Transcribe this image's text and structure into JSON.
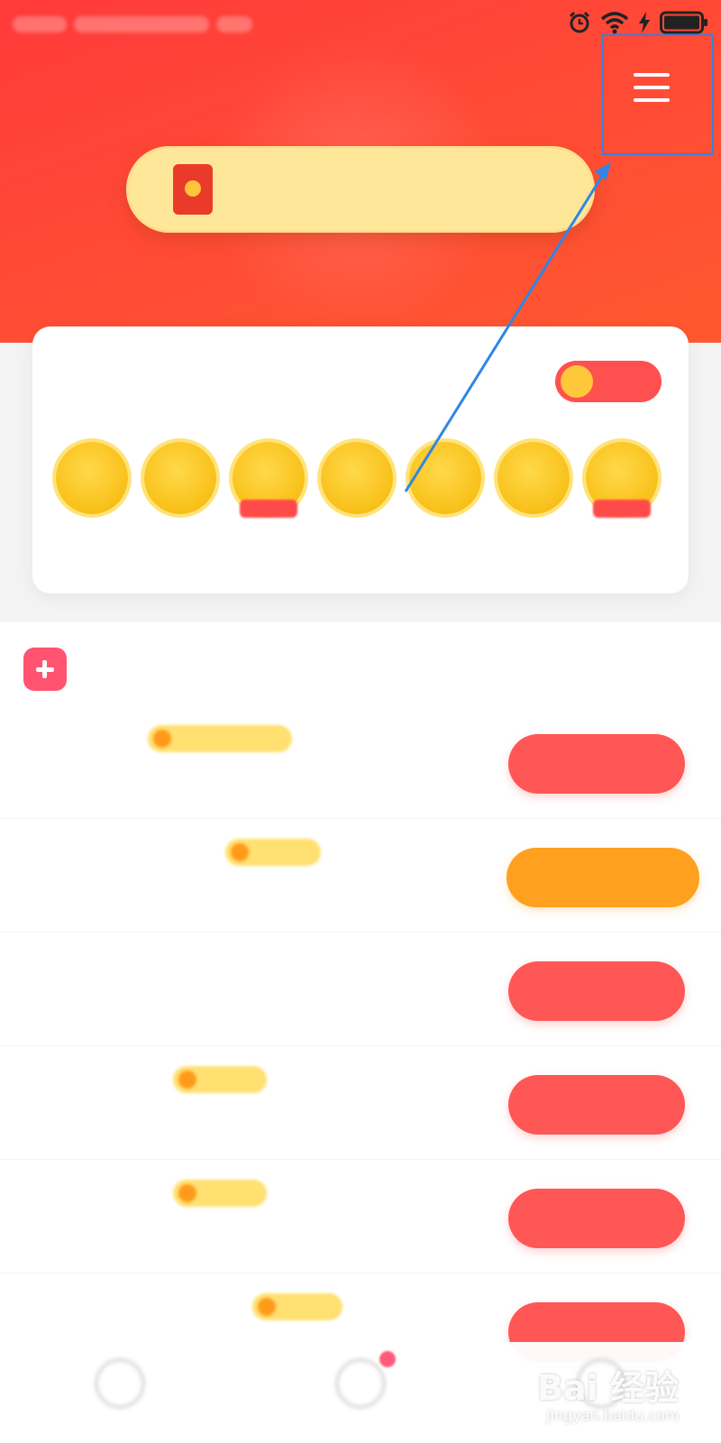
{
  "status_bar": {
    "icons": [
      "alarm-icon",
      "wifi-icon",
      "charging-icon",
      "battery-icon"
    ]
  },
  "header": {
    "menu_icon": "hamburger-menu-icon"
  },
  "banner": {
    "icon": "red-envelope-icon",
    "text": ""
  },
  "checkin": {
    "title": "",
    "toggle_label": "",
    "days": [
      {
        "label": "",
        "has_ribbon": false
      },
      {
        "label": "",
        "has_ribbon": false
      },
      {
        "label": "",
        "has_ribbon": true
      },
      {
        "label": "",
        "has_ribbon": false
      },
      {
        "label": "",
        "has_ribbon": false
      },
      {
        "label": "",
        "has_ribbon": false
      },
      {
        "label": "",
        "has_ribbon": true
      }
    ]
  },
  "tasks": {
    "title": "",
    "icon": "plus-task-icon",
    "items": [
      {
        "name": "",
        "badge": "",
        "desc": "",
        "button": "",
        "button_color": "#ff5656"
      },
      {
        "name": "",
        "badge": "",
        "desc": "",
        "button": "",
        "button_color": "#ffa01e"
      },
      {
        "name": "",
        "badge": "",
        "desc": "",
        "button": "",
        "button_color": "#ff5656"
      },
      {
        "name": "",
        "badge": "",
        "desc": "",
        "button": "",
        "button_color": "#ff5656"
      },
      {
        "name": "",
        "badge": "",
        "desc": "",
        "button": "",
        "button_color": "#ff5656"
      },
      {
        "name": "",
        "badge": "",
        "desc": "",
        "button": "",
        "button_color": "#ff5656"
      }
    ]
  },
  "bottom_nav": {
    "items": [
      {
        "label": "",
        "icon": "home-icon"
      },
      {
        "label": "",
        "icon": "task-icon"
      },
      {
        "label": "",
        "icon": "profile-icon"
      }
    ]
  },
  "watermark": {
    "main": "Bai 经验",
    "sub": "jingyan.baidu.com"
  },
  "colors": {
    "brand_red": "#ff4a3a",
    "banner_yellow": "#ffe79a",
    "coin_gold": "#f9c21c",
    "button_red": "#ff5656",
    "button_orange": "#ffa01e",
    "highlight_blue": "#3a7fe0"
  }
}
